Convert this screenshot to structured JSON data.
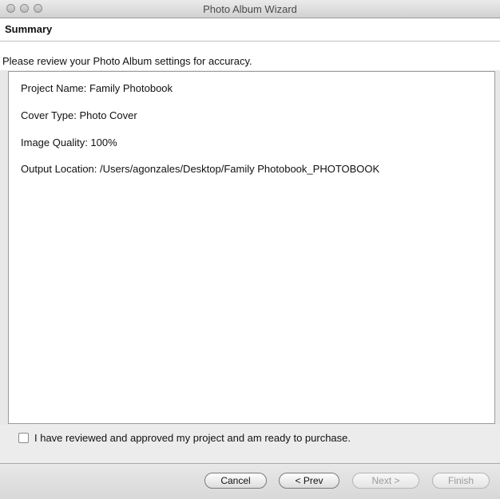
{
  "window": {
    "title": "Photo Album Wizard"
  },
  "header": {
    "label": "Summary"
  },
  "prompt": "Please review your Photo Album settings for accuracy.",
  "summary": {
    "project_name": "Project Name: Family Photobook",
    "cover_type": "Cover Type: Photo Cover",
    "image_quality": "Image Quality: 100%",
    "output_location": "Output Location: /Users/agonzales/Desktop/Family Photobook_PHOTOBOOK"
  },
  "approval": {
    "label": "I have reviewed and approved my project and am ready to purchase.",
    "checked": false
  },
  "buttons": {
    "cancel": "Cancel",
    "prev": "< Prev",
    "next": "Next >",
    "finish": "Finish"
  }
}
